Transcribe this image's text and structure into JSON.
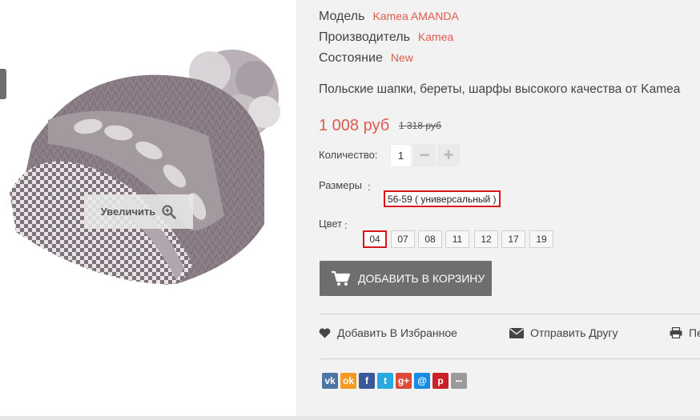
{
  "product": {
    "attributes": [
      {
        "label": "Модель",
        "value": "Kamea AMANDA"
      },
      {
        "label": "Производитель",
        "value": "Kamea"
      },
      {
        "label": "Состояние",
        "value": "New"
      }
    ],
    "description": "Польские шапки, береты, шарфы высокого качества от Kamea",
    "price": "1 008 руб",
    "old_price": "1 318 руб"
  },
  "image": {
    "zoom_label": "Увеличить"
  },
  "quantity": {
    "label": "Количество:",
    "value": "1",
    "minus": "−",
    "plus": "+"
  },
  "sizes": {
    "label": "Размеры",
    "colon": ":",
    "selected": "56-59 ( универсальный )"
  },
  "colors": {
    "label": "Цвет",
    "colon": ":",
    "options": [
      "04",
      "07",
      "08",
      "11",
      "12",
      "17",
      "19"
    ],
    "selected_index": 0
  },
  "cart": {
    "label": "ДОБАВИТЬ В КОРЗИНУ"
  },
  "actions": {
    "favorite": "Добавить В Избранное",
    "send_friend": "Отправить Другу",
    "print": "Пе"
  },
  "social": [
    {
      "icon": "vk-icon",
      "glyph": "vk",
      "color": "#4d75a3"
    },
    {
      "icon": "odnoklassniki-icon",
      "glyph": "ok",
      "color": "#f59a22"
    },
    {
      "icon": "facebook-icon",
      "glyph": "f",
      "color": "#3b5998"
    },
    {
      "icon": "twitter-icon",
      "glyph": "t",
      "color": "#2aa9e0"
    },
    {
      "icon": "google-plus-icon",
      "glyph": "g+",
      "color": "#dd4b39"
    },
    {
      "icon": "mail-icon",
      "glyph": "@",
      "color": "#168de2"
    },
    {
      "icon": "pinterest-icon",
      "glyph": "p",
      "color": "#cb2027"
    },
    {
      "icon": "more-icon",
      "glyph": "•••",
      "color": "#9a9a9a"
    }
  ],
  "colors_theme": {
    "accent": "#e05a4e",
    "selected_border": "#d9141b",
    "button_bg": "#6e6e6e"
  }
}
